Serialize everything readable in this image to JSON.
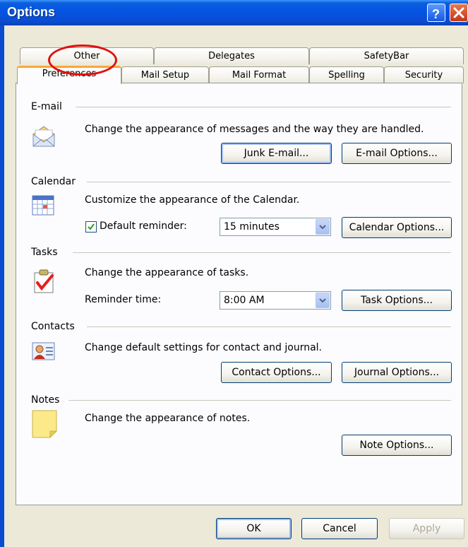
{
  "window": {
    "title": "Options",
    "help_label": "?",
    "close_label": "X"
  },
  "tabs": {
    "row1": [
      "Other",
      "Delegates",
      "SafetyBar"
    ],
    "row2": [
      "Preferences",
      "Mail Setup",
      "Mail Format",
      "Spelling",
      "Security"
    ],
    "active": "Preferences"
  },
  "sections": {
    "email": {
      "title": "E-mail",
      "description": "Change the appearance of messages and the way they are handled.",
      "junk_button": "Junk E-mail...",
      "options_button": "E-mail Options..."
    },
    "calendar": {
      "title": "Calendar",
      "description": "Customize the appearance of the Calendar.",
      "reminder_label": "Default reminder:",
      "reminder_checked": true,
      "reminder_value": "15 minutes",
      "options_button": "Calendar Options..."
    },
    "tasks": {
      "title": "Tasks",
      "description": "Change the appearance of tasks.",
      "reminder_label": "Reminder time:",
      "reminder_value": "8:00 AM",
      "options_button": "Task Options..."
    },
    "contacts": {
      "title": "Contacts",
      "description": "Change default settings for contact and journal.",
      "contact_button": "Contact Options...",
      "journal_button": "Journal Options..."
    },
    "notes": {
      "title": "Notes",
      "description": "Change the appearance of notes.",
      "options_button": "Note Options..."
    }
  },
  "footer": {
    "ok": "OK",
    "cancel": "Cancel",
    "apply": "Apply"
  },
  "icons": {
    "email": "envelope-icon",
    "calendar": "calendar-icon",
    "tasks": "task-checkmark-icon",
    "contacts": "contact-card-icon",
    "notes": "sticky-note-icon"
  },
  "colors": {
    "titlebar": "#0a4cd0",
    "tab_highlight": "#f7a839",
    "annotation_circle": "#e0100c"
  }
}
